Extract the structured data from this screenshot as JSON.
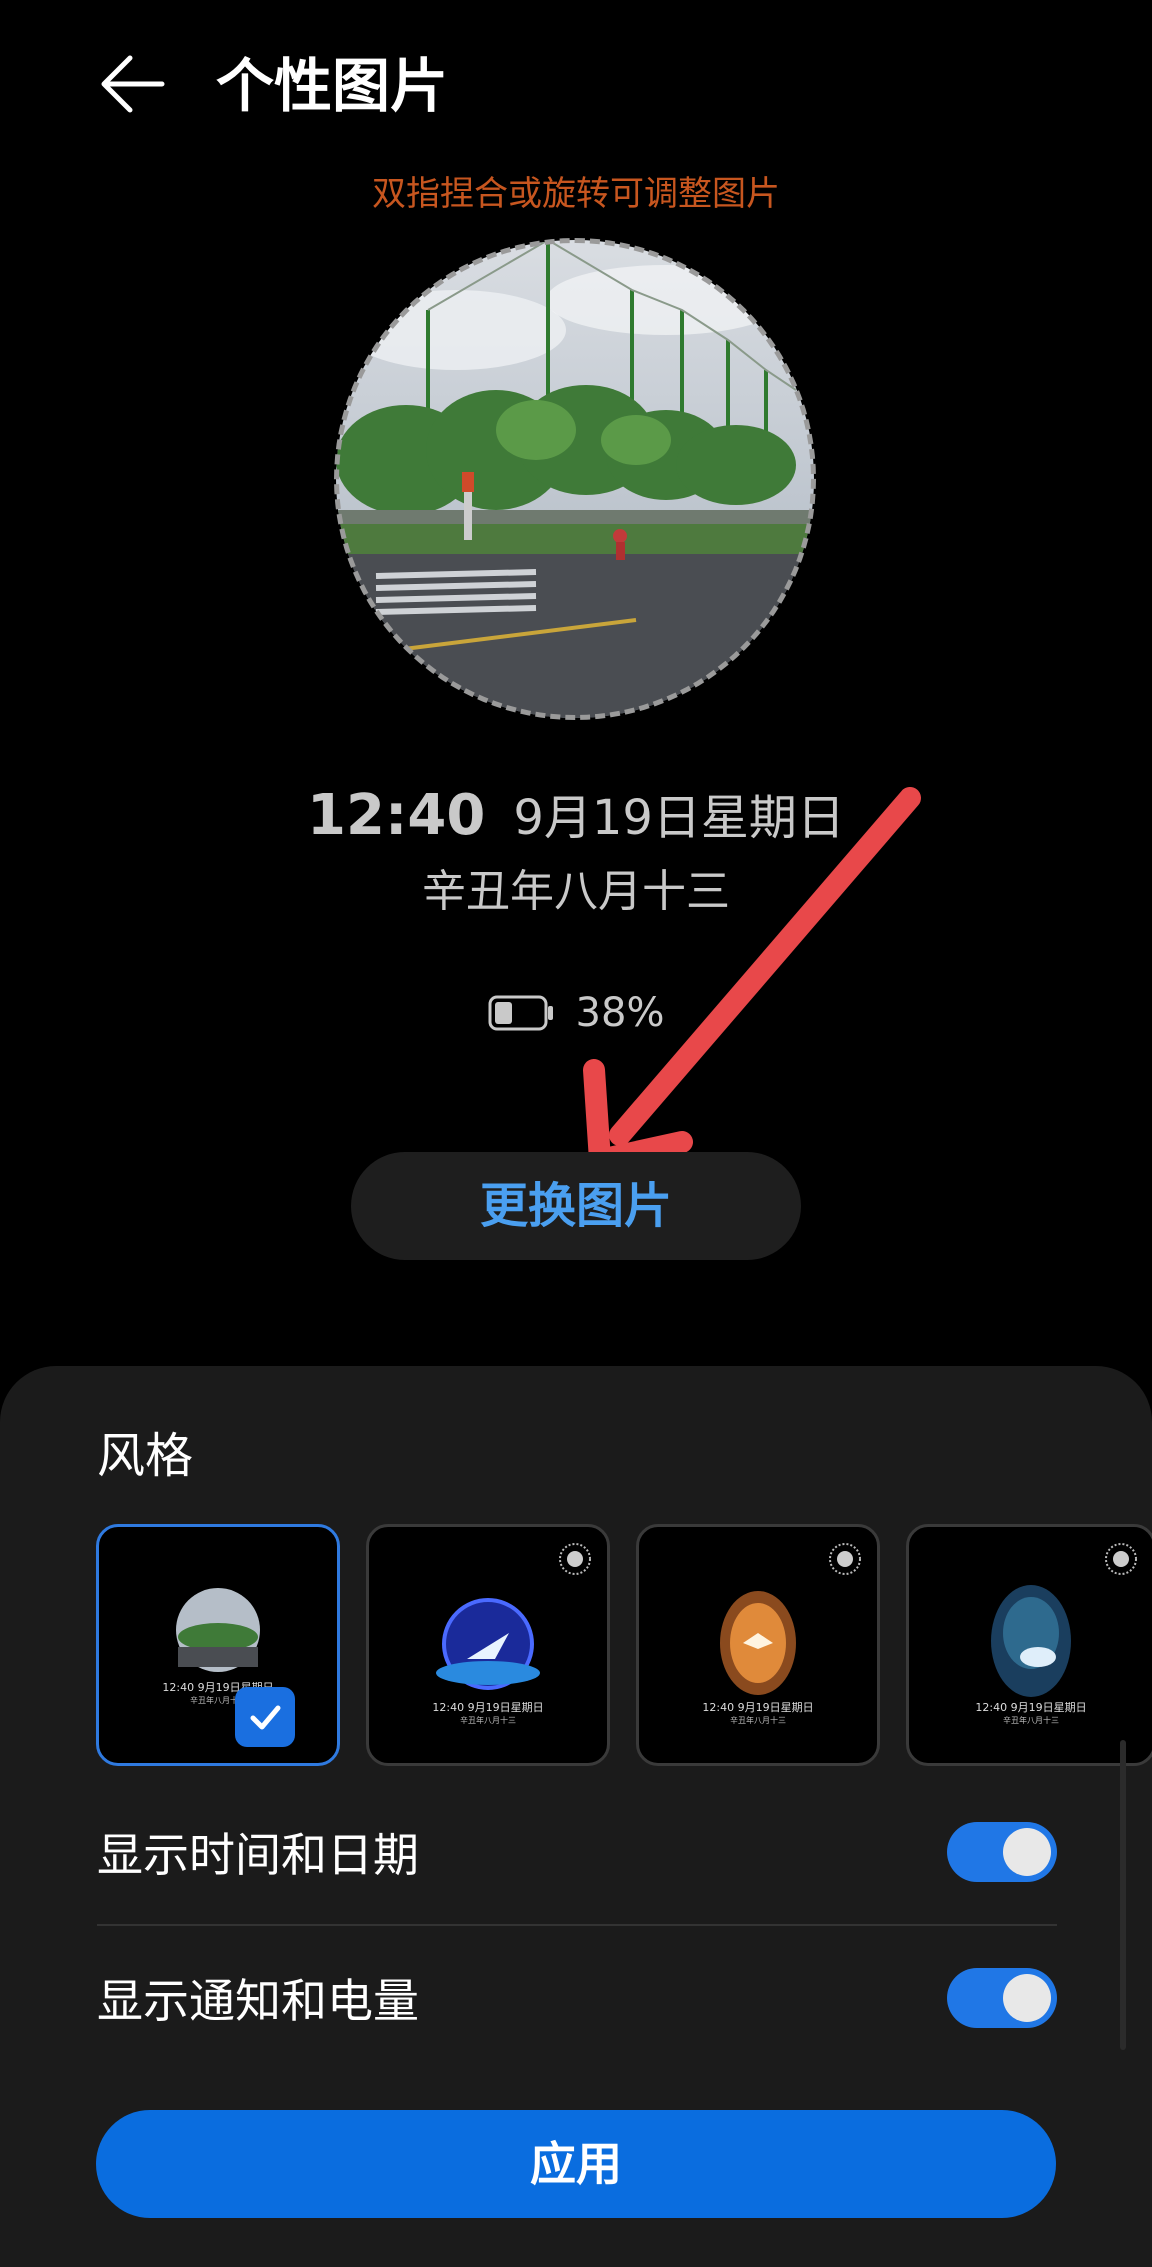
{
  "header": {
    "title": "个性图片",
    "back_icon": "arrow-left-icon"
  },
  "preview": {
    "hint": "双指捏合或旋转可调整图片",
    "time": "12:40",
    "date": "9月19日星期日",
    "lunar": "辛丑年八月十三",
    "battery_percent": "38%",
    "battery_level": 0.38
  },
  "change_button": {
    "label": "更换图片"
  },
  "style_section": {
    "label": "风格",
    "cards": [
      {
        "name": "photo-circle",
        "time": "12:40 9月19日星期日",
        "lunar": "辛丑年八月十三",
        "selected": true
      },
      {
        "name": "blue-bird",
        "time": "12:40 9月19日星期日",
        "lunar": "辛丑年八月十三",
        "selected": false
      },
      {
        "name": "orange-bird",
        "time": "12:40 9月19日星期日",
        "lunar": "辛丑年八月十三",
        "selected": false
      },
      {
        "name": "dolphin",
        "time": "12:40 9月19日星期日",
        "lunar": "辛丑年八月十三",
        "selected": false
      }
    ]
  },
  "toggles": [
    {
      "label": "显示时间和日期",
      "on": true
    },
    {
      "label": "显示通知和电量",
      "on": true
    }
  ],
  "apply_button": {
    "label": "应用"
  },
  "colors": {
    "accent": "#0a6ddf",
    "hint": "#c7561f",
    "arrow": "#e8484a"
  }
}
